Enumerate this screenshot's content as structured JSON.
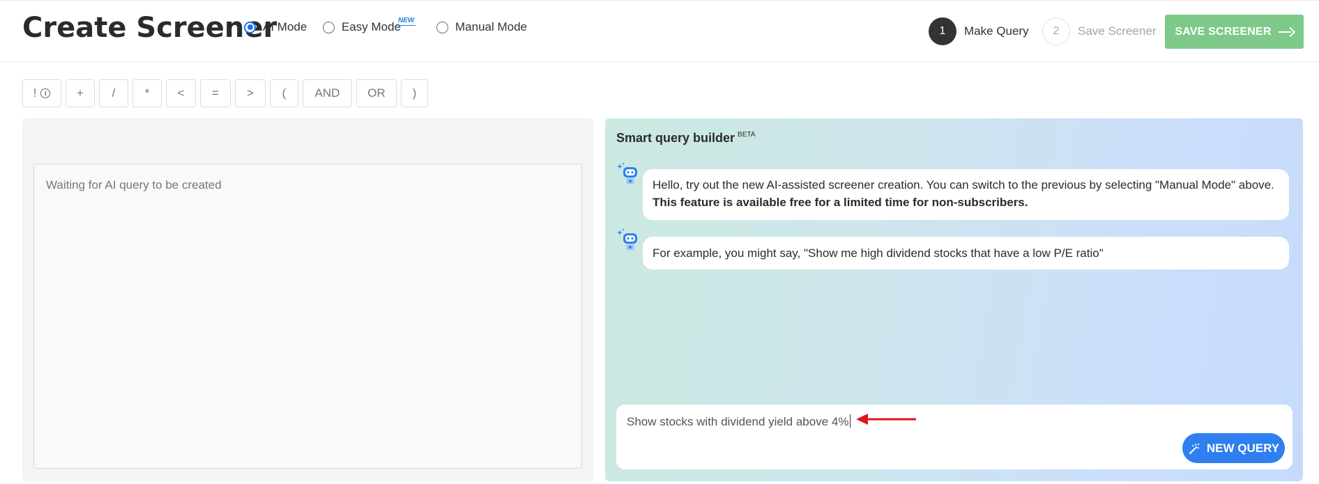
{
  "header": {
    "title": "Create Screener",
    "modes": [
      {
        "label": "AI Mode",
        "selected": true
      },
      {
        "label": "Easy Mode",
        "selected": false,
        "badge": "NEW"
      },
      {
        "label": "Manual Mode",
        "selected": false
      }
    ],
    "steps": [
      {
        "number": "1",
        "label": "Make Query",
        "active": true
      },
      {
        "number": "2",
        "label": "Save Screener",
        "active": false
      }
    ],
    "save_label": "SAVE SCREENER",
    "save_icon": "arrow-right-icon"
  },
  "operators": [
    "!",
    "+",
    "/",
    "*",
    "<",
    "=",
    ">",
    "(",
    "AND",
    "OR",
    ")"
  ],
  "operator_info_icon": "i",
  "query_panel": {
    "placeholder": "Waiting for AI query to be created"
  },
  "builder": {
    "title": "Smart query builder",
    "title_sup": "BETA",
    "messages": [
      {
        "text": "Hello, try out the new AI-assisted screener creation. You can switch to the previous by selecting \"Manual Mode\" above. ",
        "bold": "This feature is available free for a limited time for non-subscribers."
      },
      {
        "text": "For example, you might say, \"Show me high dividend stocks that have a low P/E ratio\"",
        "bold": ""
      }
    ],
    "input_value": "Show stocks with dividend yield above 4%",
    "new_query_label": "NEW QUERY",
    "new_query_icon": "magic-wand-icon"
  },
  "colors": {
    "accent_blue": "#2f7ff0",
    "save_green": "#7ec98a",
    "annotation_red": "#e0141e"
  }
}
